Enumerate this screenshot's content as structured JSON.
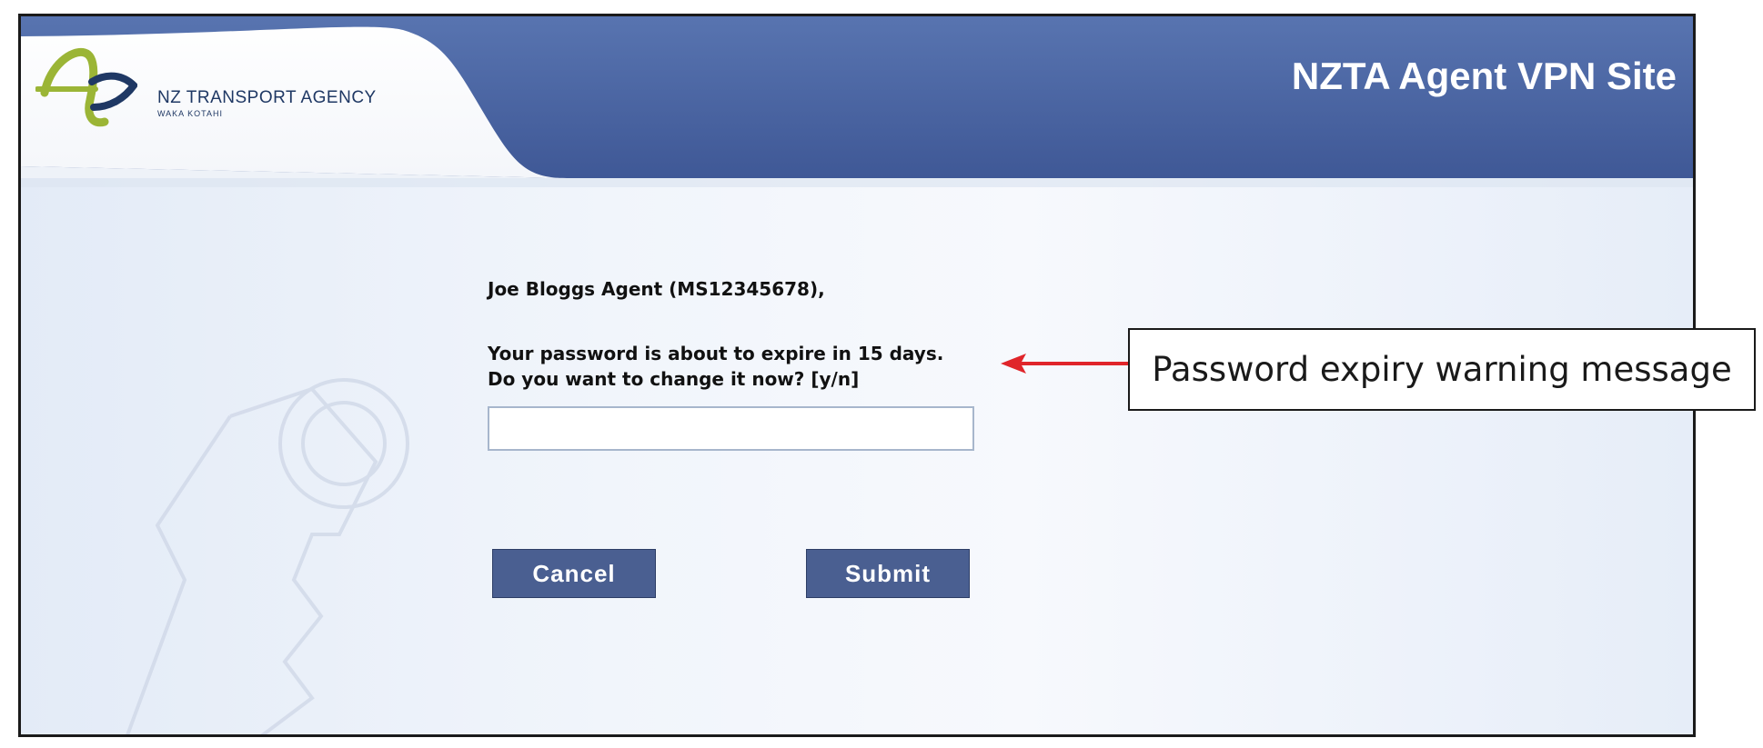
{
  "header": {
    "logo_title": "NZ TRANSPORT AGENCY",
    "logo_subtitle": "WAKA KOTAHI",
    "site_title": "NZTA Agent VPN Site"
  },
  "prompt": {
    "greeting": "Joe Bloggs Agent (MS12345678),",
    "message_line1": "Your password is about to expire in 15 days.",
    "message_line2": "Do you want to change it now? [y/n]",
    "input_value": ""
  },
  "buttons": {
    "cancel_label": "Cancel",
    "submit_label": "Submit"
  },
  "annotation": {
    "callout_text": "Password expiry warning message",
    "arrow_color": "#e0252a"
  },
  "colors": {
    "header_blue": "#4f6aa8",
    "button_blue": "#4a5f91",
    "logo_green": "#9bb536",
    "logo_navy": "#1f3864"
  }
}
